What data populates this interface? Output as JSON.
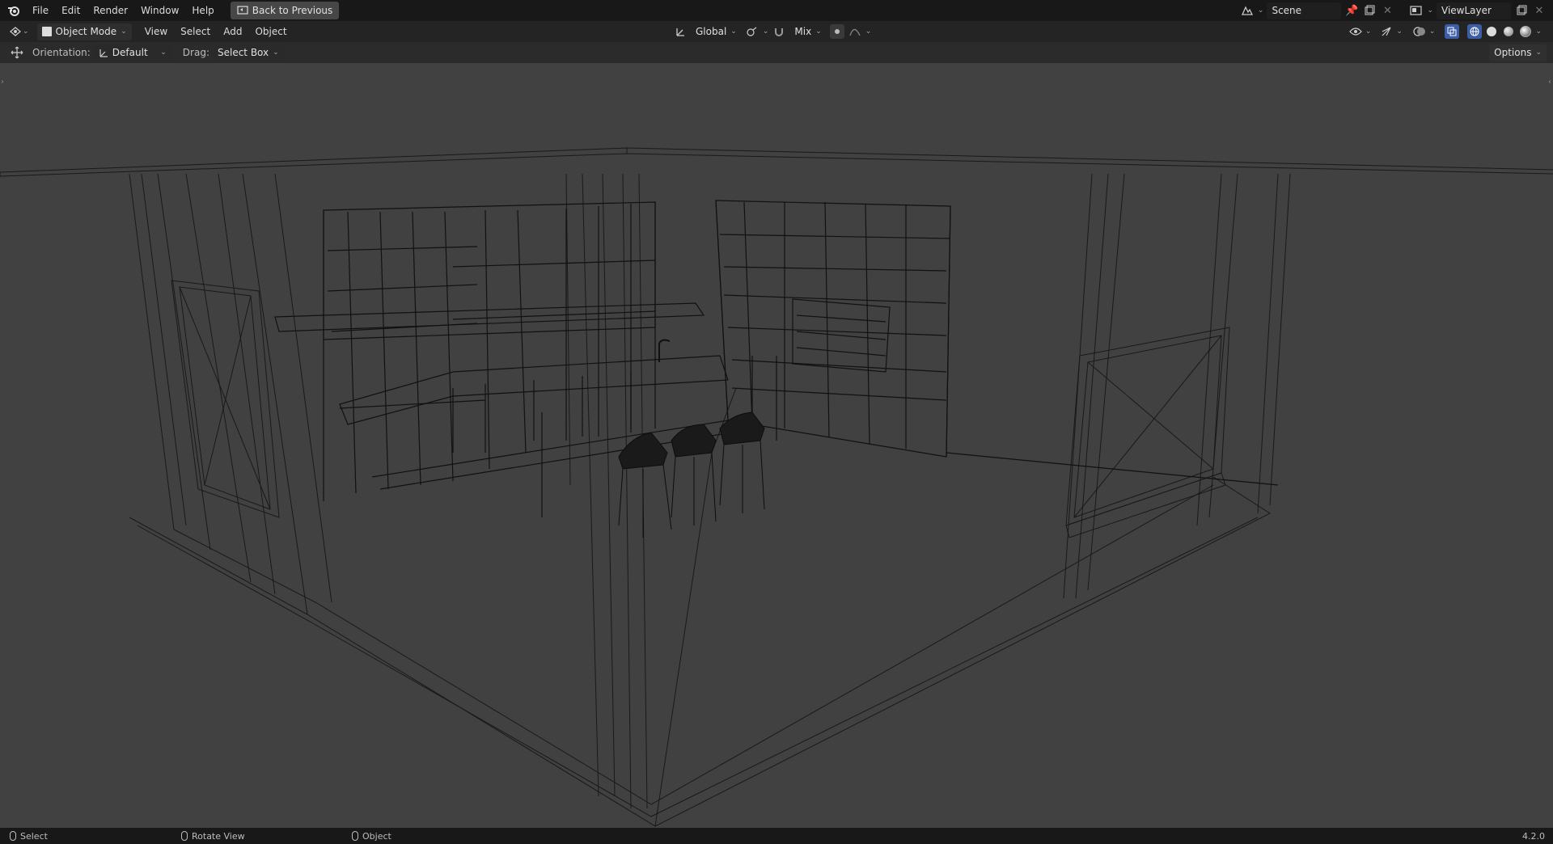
{
  "topbar": {
    "menu": [
      "File",
      "Edit",
      "Render",
      "Window",
      "Help"
    ],
    "back_button": "Back to Previous",
    "scene_name": "Scene",
    "viewlayer_name": "ViewLayer"
  },
  "header": {
    "mode": "Object Mode",
    "menu": [
      "View",
      "Select",
      "Add",
      "Object"
    ],
    "transform_orientation": "Global",
    "snap_mode": "Mix"
  },
  "toolbar": {
    "orientation_label": "Orientation:",
    "orientation_value": "Default",
    "drag_label": "Drag:",
    "drag_value": "Select Box",
    "options_label": "Options"
  },
  "status": {
    "select": "Select",
    "rotate": "Rotate View",
    "object": "Object",
    "version": "4.2.0"
  },
  "colors": {
    "viewport_bg": "#414141",
    "wire": "#141414",
    "active_shading": "#3d5ea6"
  }
}
